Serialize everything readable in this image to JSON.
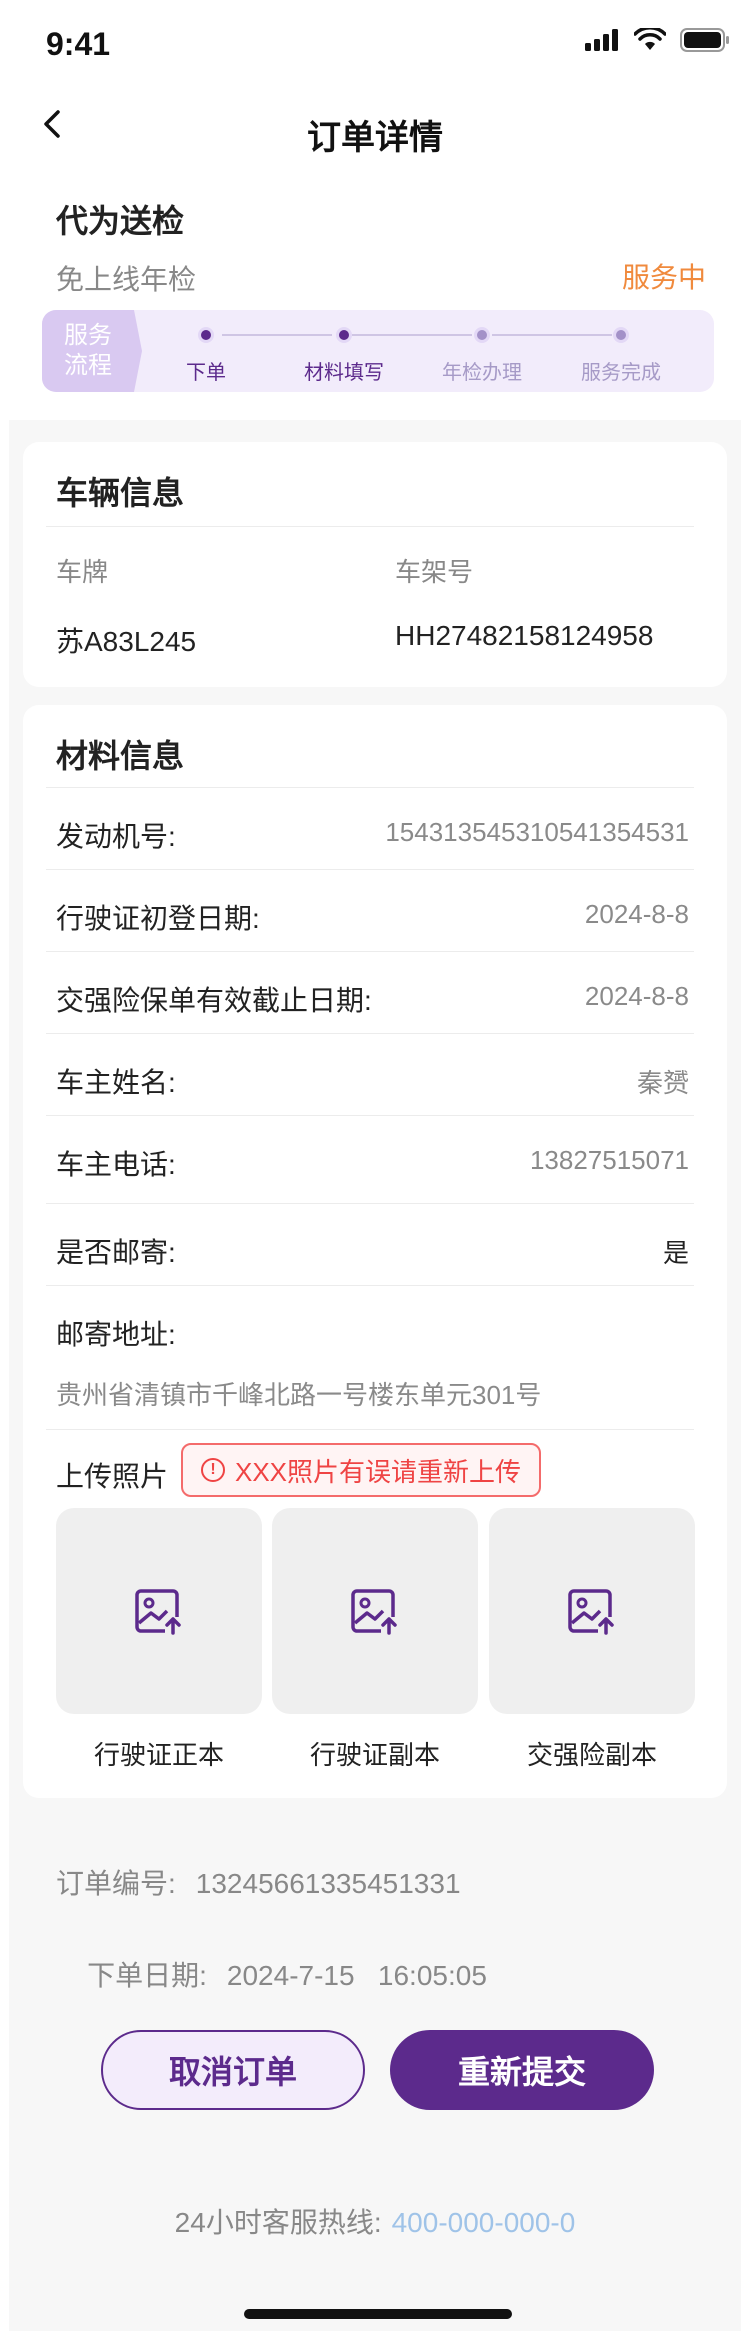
{
  "status_bar": {
    "time": "9:41"
  },
  "nav": {
    "title": "订单详情"
  },
  "service": {
    "title": "代为送检",
    "subtitle": "免上线年检",
    "status": "服务中",
    "status_color": "#f08a3d",
    "flow_tag_line1": "服务",
    "flow_tag_line2": "流程",
    "steps": [
      {
        "label": "下单",
        "state": "done"
      },
      {
        "label": "材料填写",
        "state": "done"
      },
      {
        "label": "年检办理",
        "state": "pending"
      },
      {
        "label": "服务完成",
        "state": "pending"
      }
    ]
  },
  "vehicle": {
    "title": "车辆信息",
    "plate_label": "车牌",
    "plate_value": "苏A83L245",
    "vin_label": "车架号",
    "vin_value": "HH27482158124958"
  },
  "materials": {
    "title": "材料信息",
    "rows": [
      {
        "label": "发动机号:",
        "value": "154313545310541354531"
      },
      {
        "label": "行驶证初登日期:",
        "value": "2024-8-8"
      },
      {
        "label": "交强险保单有效截止日期:",
        "value": "2024-8-8"
      },
      {
        "label": "车主姓名:",
        "value": "秦赟"
      },
      {
        "label": "车主电话:",
        "value": "13827515071"
      },
      {
        "label": "是否邮寄:",
        "value": "是"
      }
    ],
    "address_label": "邮寄地址:",
    "address_value": "贵州省清镇市千峰北路一号楼东单元301号",
    "upload_label": "上传照片",
    "upload_error": "XXX照片有误请重新上传",
    "photos": [
      "行驶证正本",
      "行驶证副本",
      "交强险副本"
    ]
  },
  "order": {
    "number_label": "订单编号:",
    "number_value": "13245661335451331",
    "date_label": "下单日期:",
    "date_value": "2024-7-15   16:05:05"
  },
  "actions": {
    "cancel_label": "取消订单",
    "resubmit_label": "重新提交"
  },
  "hotline": {
    "label": "24小时客服热线:",
    "number": "400-000-000-0"
  },
  "colors": {
    "brand": "#5c2a8c",
    "error": "#ef4444",
    "accent": "#f08a3d"
  }
}
